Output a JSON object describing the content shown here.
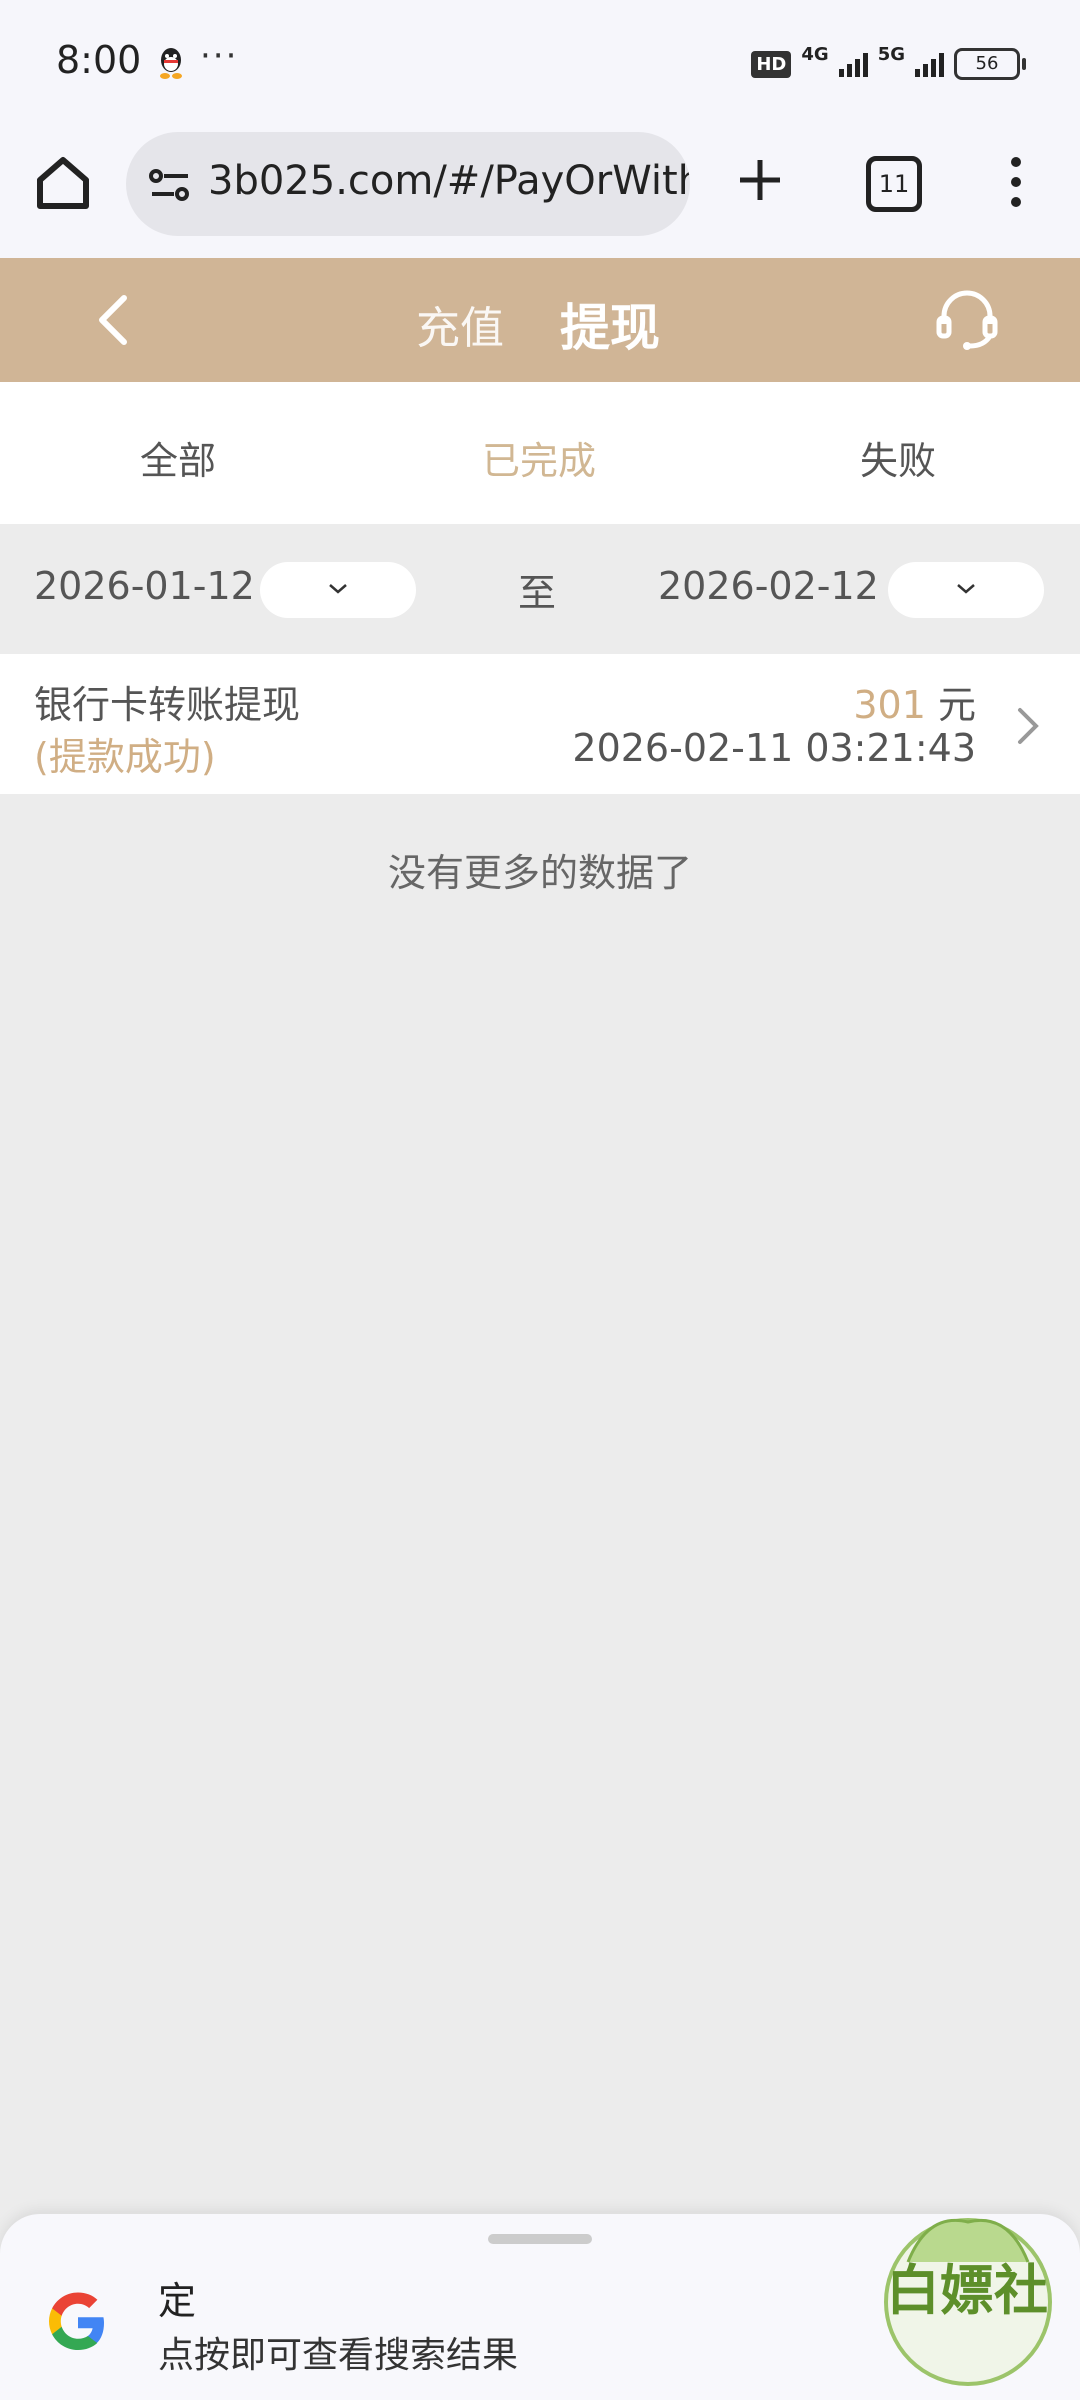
{
  "status_bar": {
    "time": "8:00",
    "dots": "···",
    "hd": "HD",
    "net1": "4G",
    "net2": "5G",
    "battery": "56"
  },
  "browser": {
    "url": "3b025.com/#/PayOrWith",
    "tab_count": "11"
  },
  "header": {
    "tab_recharge": "充值",
    "tab_withdraw": "提现",
    "accent_color": "#d0b596"
  },
  "filters": {
    "all": "全部",
    "completed": "已完成",
    "failed": "失败"
  },
  "date_range": {
    "start": "2026-01-12",
    "separator": "至",
    "end": "2026-02-12"
  },
  "record": {
    "title": "银行卡转账提现",
    "status": "(提款成功)",
    "amount": "301",
    "currency": "元",
    "time": "2026-02-11 03:21:43"
  },
  "no_more": "没有更多的数据了",
  "bottom_sheet": {
    "title": "定",
    "subtitle": "点按即可查看搜索结果"
  },
  "watermark": "白嫖社"
}
